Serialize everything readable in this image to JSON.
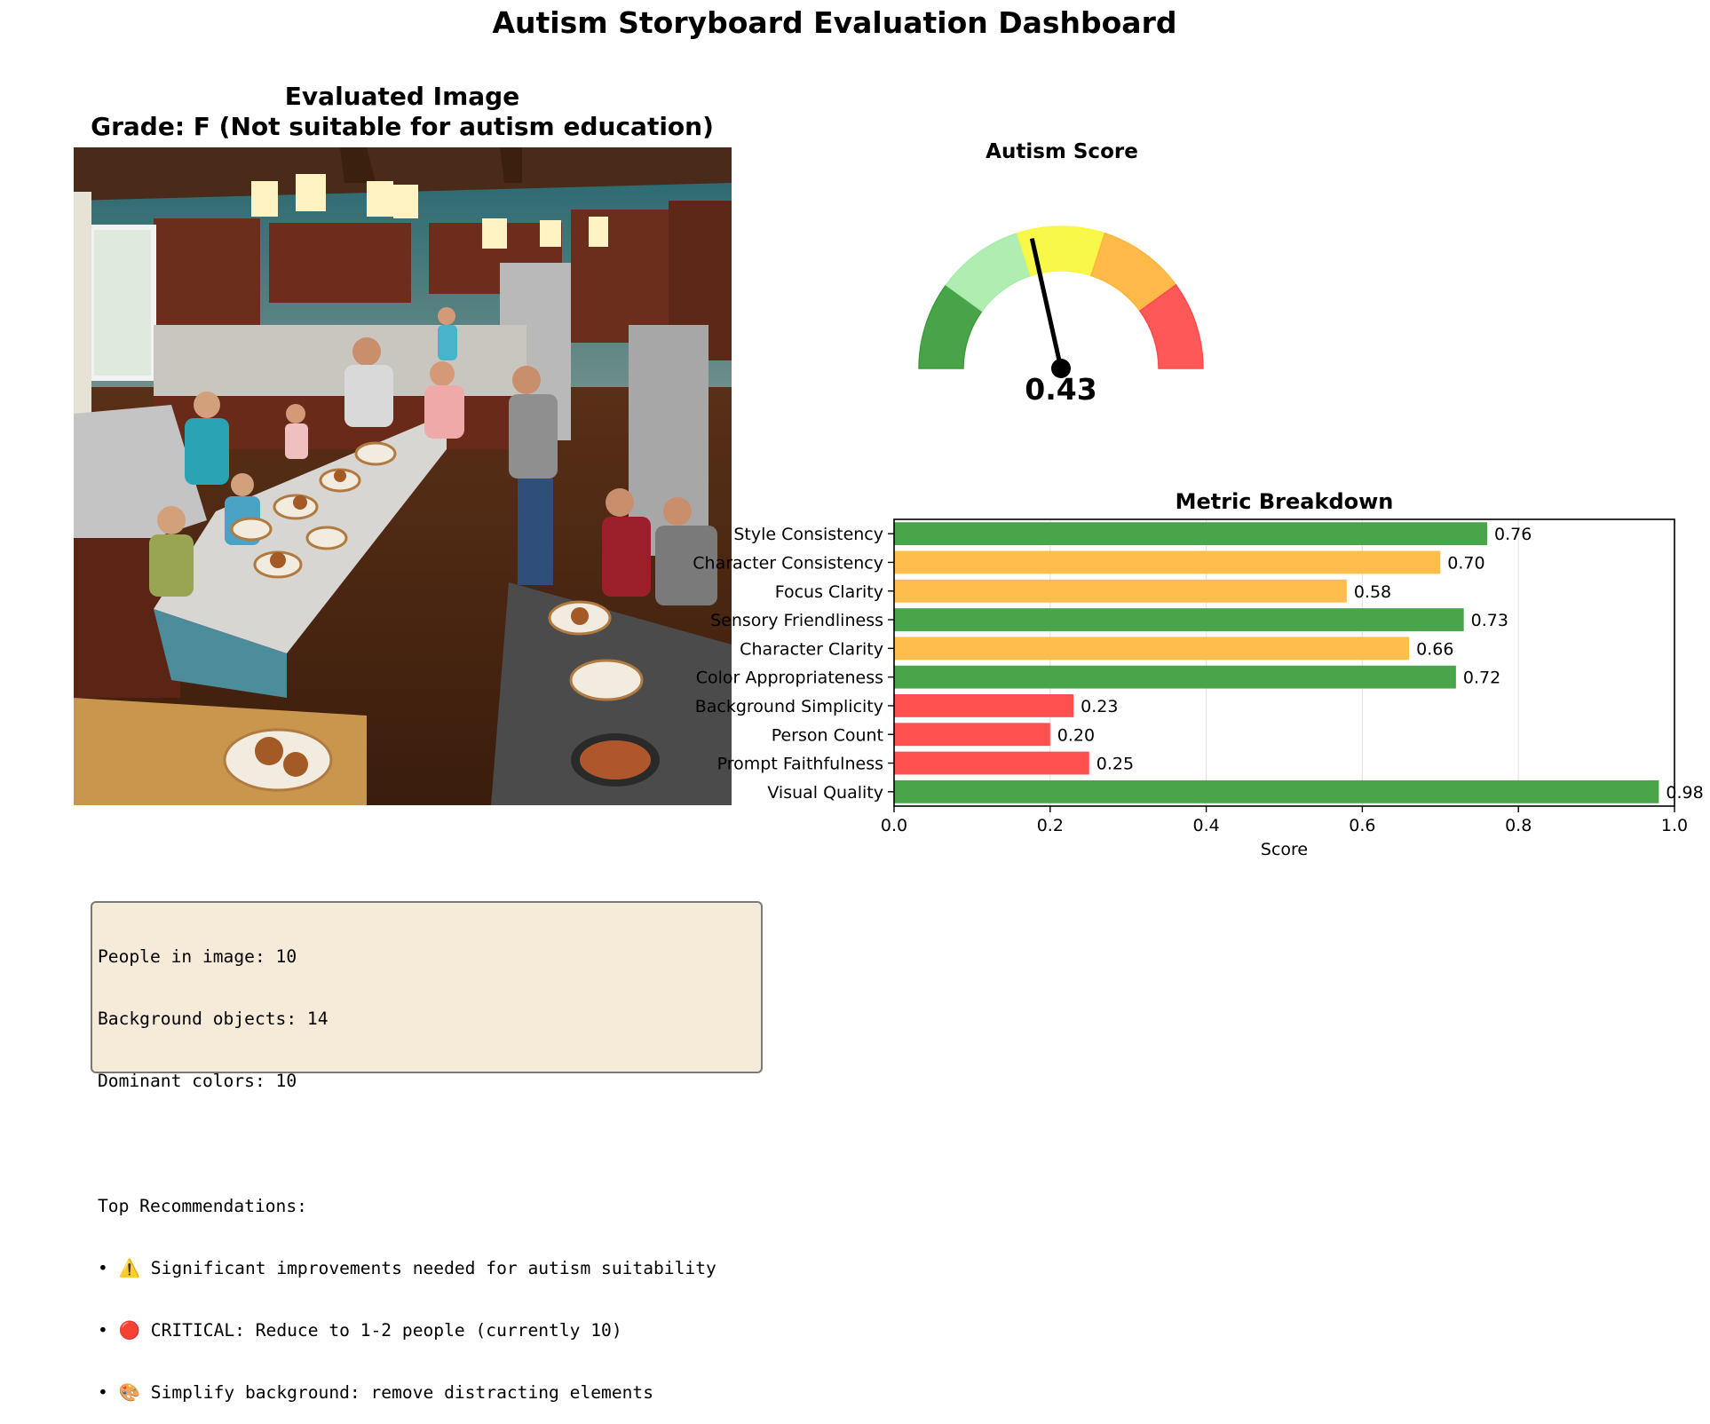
{
  "dashboard": {
    "title": "Autism Storyboard Evaluation Dashboard"
  },
  "image_panel": {
    "title_line1": "Evaluated Image",
    "title_line2": "Grade: F (Not suitable for autism education)"
  },
  "gauge": {
    "title": "Autism Score",
    "value": 0.43,
    "value_label": "0.43",
    "segments": [
      {
        "from": 0.0,
        "to": 0.2,
        "color": "#3a9c3a"
      },
      {
        "from": 0.2,
        "to": 0.4,
        "color": "#a9ecaa"
      },
      {
        "from": 0.4,
        "to": 0.6,
        "color": "#f7f73c"
      },
      {
        "from": 0.6,
        "to": 0.8,
        "color": "#ffb43a"
      },
      {
        "from": 0.8,
        "to": 1.0,
        "color": "#ff4a4a"
      }
    ]
  },
  "chart_data": {
    "type": "bar",
    "orientation": "horizontal",
    "title": "Metric Breakdown",
    "xlabel": "Score",
    "ylabel": "",
    "xlim": [
      0,
      1
    ],
    "xticks": [
      "0.0",
      "0.2",
      "0.4",
      "0.6",
      "0.8",
      "1.0"
    ],
    "grid": "x",
    "categories": [
      "Style Consistency",
      "Character Consistency",
      "Focus Clarity",
      "Sensory Friendliness",
      "Character Clarity",
      "Color Appropriateness",
      "Background Simplicity",
      "Person Count",
      "Prompt Faithfulness",
      "Visual Quality"
    ],
    "values": [
      0.76,
      0.7,
      0.58,
      0.73,
      0.66,
      0.72,
      0.23,
      0.2,
      0.25,
      0.98
    ],
    "value_labels": [
      "0.76",
      "0.70",
      "0.58",
      "0.73",
      "0.66",
      "0.72",
      "0.23",
      "0.20",
      "0.25",
      "0.98"
    ],
    "colors": [
      "#4aa54a",
      "#ffbd4c",
      "#ffbd4c",
      "#4aa54a",
      "#ffbd4c",
      "#4aa54a",
      "#ff5050",
      "#ff5050",
      "#ff5050",
      "#4aa54a"
    ]
  },
  "info_box": {
    "lines": [
      "People in image: 10",
      "Background objects: 14",
      "Dominant colors: 10",
      "",
      "Top Recommendations:",
      "• ⚠️ Significant improvements needed for autism suitability",
      "• 🔴 CRITICAL: Reduce to 1-2 people (currently 10)",
      "• 🎨 Simplify background: remove distracting elements"
    ]
  }
}
